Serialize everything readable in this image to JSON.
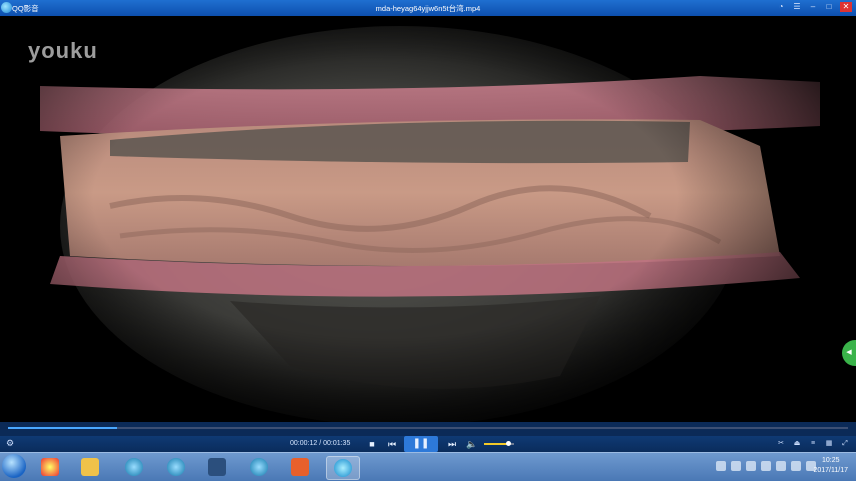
{
  "titlebar": {
    "app_name": "QQ影音",
    "file_title": "mda-heyag64yjjw6n5t台湾.mp4"
  },
  "video": {
    "watermark": "youku"
  },
  "player": {
    "time_display": "00:00:12 / 00:01:35",
    "progress_fraction": 0.13,
    "volume_fraction": 0.8
  },
  "colors": {
    "accent": "#2d79d9",
    "titlebar": "#1f6fd0"
  },
  "taskbar": {
    "time": "10:25",
    "date": "2017/11/17"
  }
}
